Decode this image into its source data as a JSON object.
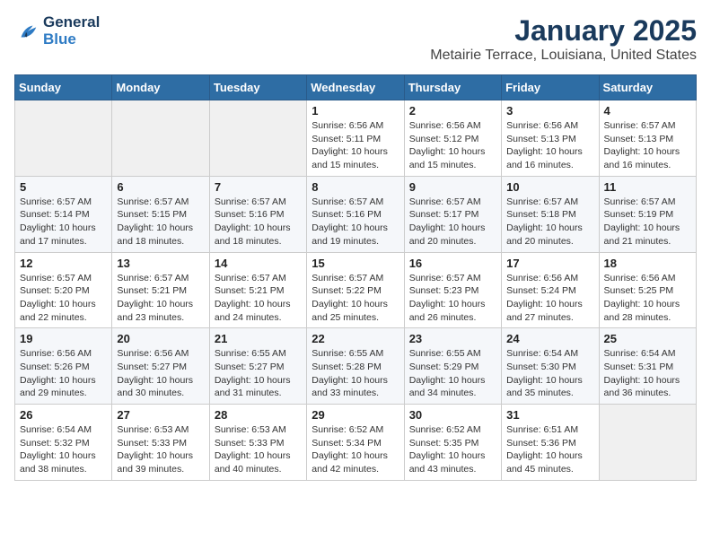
{
  "header": {
    "logo_line1": "General",
    "logo_line2": "Blue",
    "month": "January 2025",
    "location": "Metairie Terrace, Louisiana, United States"
  },
  "weekdays": [
    "Sunday",
    "Monday",
    "Tuesday",
    "Wednesday",
    "Thursday",
    "Friday",
    "Saturday"
  ],
  "weeks": [
    [
      {
        "day": "",
        "info": ""
      },
      {
        "day": "",
        "info": ""
      },
      {
        "day": "",
        "info": ""
      },
      {
        "day": "1",
        "info": "Sunrise: 6:56 AM\nSunset: 5:11 PM\nDaylight: 10 hours and 15 minutes."
      },
      {
        "day": "2",
        "info": "Sunrise: 6:56 AM\nSunset: 5:12 PM\nDaylight: 10 hours and 15 minutes."
      },
      {
        "day": "3",
        "info": "Sunrise: 6:56 AM\nSunset: 5:13 PM\nDaylight: 10 hours and 16 minutes."
      },
      {
        "day": "4",
        "info": "Sunrise: 6:57 AM\nSunset: 5:13 PM\nDaylight: 10 hours and 16 minutes."
      }
    ],
    [
      {
        "day": "5",
        "info": "Sunrise: 6:57 AM\nSunset: 5:14 PM\nDaylight: 10 hours and 17 minutes."
      },
      {
        "day": "6",
        "info": "Sunrise: 6:57 AM\nSunset: 5:15 PM\nDaylight: 10 hours and 18 minutes."
      },
      {
        "day": "7",
        "info": "Sunrise: 6:57 AM\nSunset: 5:16 PM\nDaylight: 10 hours and 18 minutes."
      },
      {
        "day": "8",
        "info": "Sunrise: 6:57 AM\nSunset: 5:16 PM\nDaylight: 10 hours and 19 minutes."
      },
      {
        "day": "9",
        "info": "Sunrise: 6:57 AM\nSunset: 5:17 PM\nDaylight: 10 hours and 20 minutes."
      },
      {
        "day": "10",
        "info": "Sunrise: 6:57 AM\nSunset: 5:18 PM\nDaylight: 10 hours and 20 minutes."
      },
      {
        "day": "11",
        "info": "Sunrise: 6:57 AM\nSunset: 5:19 PM\nDaylight: 10 hours and 21 minutes."
      }
    ],
    [
      {
        "day": "12",
        "info": "Sunrise: 6:57 AM\nSunset: 5:20 PM\nDaylight: 10 hours and 22 minutes."
      },
      {
        "day": "13",
        "info": "Sunrise: 6:57 AM\nSunset: 5:21 PM\nDaylight: 10 hours and 23 minutes."
      },
      {
        "day": "14",
        "info": "Sunrise: 6:57 AM\nSunset: 5:21 PM\nDaylight: 10 hours and 24 minutes."
      },
      {
        "day": "15",
        "info": "Sunrise: 6:57 AM\nSunset: 5:22 PM\nDaylight: 10 hours and 25 minutes."
      },
      {
        "day": "16",
        "info": "Sunrise: 6:57 AM\nSunset: 5:23 PM\nDaylight: 10 hours and 26 minutes."
      },
      {
        "day": "17",
        "info": "Sunrise: 6:56 AM\nSunset: 5:24 PM\nDaylight: 10 hours and 27 minutes."
      },
      {
        "day": "18",
        "info": "Sunrise: 6:56 AM\nSunset: 5:25 PM\nDaylight: 10 hours and 28 minutes."
      }
    ],
    [
      {
        "day": "19",
        "info": "Sunrise: 6:56 AM\nSunset: 5:26 PM\nDaylight: 10 hours and 29 minutes."
      },
      {
        "day": "20",
        "info": "Sunrise: 6:56 AM\nSunset: 5:27 PM\nDaylight: 10 hours and 30 minutes."
      },
      {
        "day": "21",
        "info": "Sunrise: 6:55 AM\nSunset: 5:27 PM\nDaylight: 10 hours and 31 minutes."
      },
      {
        "day": "22",
        "info": "Sunrise: 6:55 AM\nSunset: 5:28 PM\nDaylight: 10 hours and 33 minutes."
      },
      {
        "day": "23",
        "info": "Sunrise: 6:55 AM\nSunset: 5:29 PM\nDaylight: 10 hours and 34 minutes."
      },
      {
        "day": "24",
        "info": "Sunrise: 6:54 AM\nSunset: 5:30 PM\nDaylight: 10 hours and 35 minutes."
      },
      {
        "day": "25",
        "info": "Sunrise: 6:54 AM\nSunset: 5:31 PM\nDaylight: 10 hours and 36 minutes."
      }
    ],
    [
      {
        "day": "26",
        "info": "Sunrise: 6:54 AM\nSunset: 5:32 PM\nDaylight: 10 hours and 38 minutes."
      },
      {
        "day": "27",
        "info": "Sunrise: 6:53 AM\nSunset: 5:33 PM\nDaylight: 10 hours and 39 minutes."
      },
      {
        "day": "28",
        "info": "Sunrise: 6:53 AM\nSunset: 5:33 PM\nDaylight: 10 hours and 40 minutes."
      },
      {
        "day": "29",
        "info": "Sunrise: 6:52 AM\nSunset: 5:34 PM\nDaylight: 10 hours and 42 minutes."
      },
      {
        "day": "30",
        "info": "Sunrise: 6:52 AM\nSunset: 5:35 PM\nDaylight: 10 hours and 43 minutes."
      },
      {
        "day": "31",
        "info": "Sunrise: 6:51 AM\nSunset: 5:36 PM\nDaylight: 10 hours and 45 minutes."
      },
      {
        "day": "",
        "info": ""
      }
    ]
  ]
}
